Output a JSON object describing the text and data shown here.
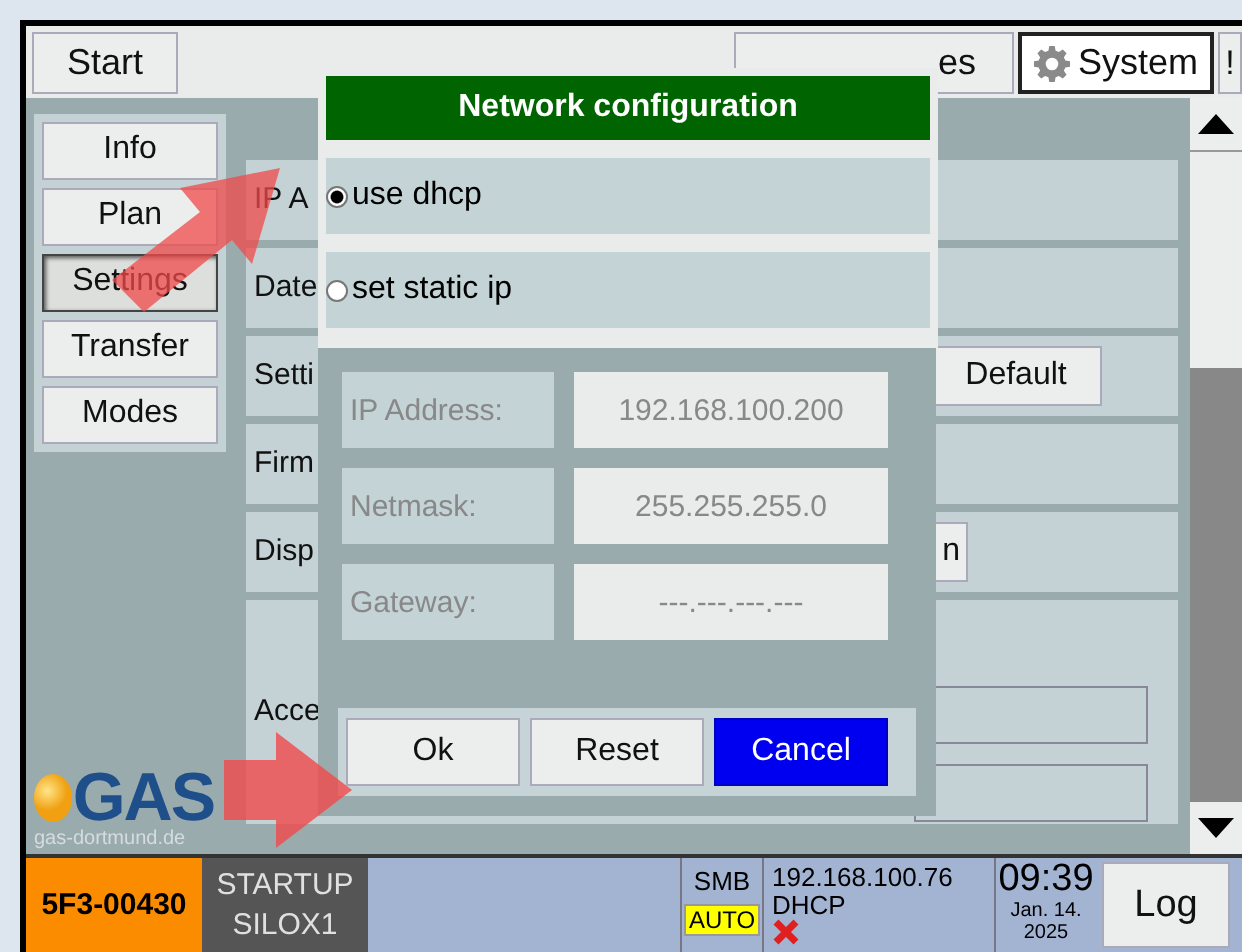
{
  "top_bar": {
    "start_button": "Start",
    "hidden_tab": "es",
    "system_button": "System",
    "alert_button": "!"
  },
  "sidebar": {
    "items": [
      {
        "label": "Info",
        "selected": false
      },
      {
        "label": "Plan",
        "selected": false
      },
      {
        "label": "Settings",
        "selected": true
      },
      {
        "label": "Transfer",
        "selected": false
      },
      {
        "label": "Modes",
        "selected": false
      }
    ]
  },
  "settings_rows": [
    {
      "label": "IP A",
      "kind": "plain"
    },
    {
      "label": "Date",
      "kind": "plain"
    },
    {
      "label": "Setti",
      "kind": "button",
      "button": "Default"
    },
    {
      "label": "Firm",
      "kind": "plain"
    },
    {
      "label": "Disp",
      "kind": "button",
      "button": "n"
    },
    {
      "label": "Acce",
      "kind": "inputs"
    }
  ],
  "logo": {
    "text": "GAS",
    "url": "gas-dortmund.de"
  },
  "dialog": {
    "title": "Network configuration",
    "options": [
      {
        "label": "use dhcp",
        "selected": true
      },
      {
        "label": "set static ip",
        "selected": false
      }
    ],
    "fields_disabled": true,
    "fields": [
      {
        "label": "IP Address:",
        "value": "192.168.100.200"
      },
      {
        "label": "Netmask:",
        "value": "255.255.255.0"
      },
      {
        "label": "Gateway:",
        "value": "---.---.---.---"
      }
    ],
    "buttons": [
      {
        "label": "Ok",
        "kind": "normal"
      },
      {
        "label": "Reset",
        "kind": "normal"
      },
      {
        "label": "Cancel",
        "kind": "primary"
      }
    ]
  },
  "status_bar": {
    "device_id": "5F3-00430",
    "state": "STARTUP",
    "silo": "SILOX1",
    "protocol": "SMB",
    "mode": "AUTO",
    "ip": "192.168.100.76",
    "ip_mode": "DHCP",
    "connected": false,
    "time": "09:39",
    "date": "Jan. 14. 2025",
    "log_button": "Log"
  }
}
